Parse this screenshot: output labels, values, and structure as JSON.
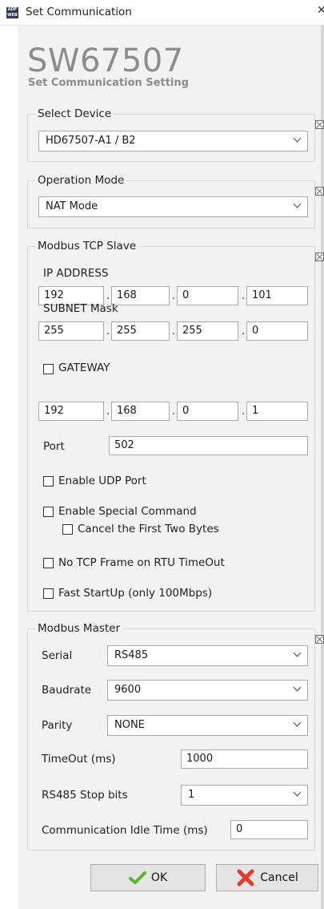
{
  "window": {
    "title": "Set Communication",
    "close_glyph": "✕"
  },
  "icons": {
    "app": "adfweb-logo-icon",
    "close": "close-icon",
    "fold": "collapse-icon",
    "chevron": "chevron-down-icon",
    "ok": "checkmark-icon",
    "cancel": "cross-icon"
  },
  "colors": {
    "ok_check": "#5cb531",
    "cancel_x": "#e23b2b"
  },
  "header": {
    "brand": "SW67507",
    "subtitle": "Set Communication Setting"
  },
  "select_device": {
    "legend": "Select Device",
    "value": "HD67507-A1 / B2"
  },
  "operation_mode": {
    "legend": "Operation Mode",
    "value": "NAT Mode"
  },
  "tcp_slave": {
    "legend": "Modbus TCP Slave",
    "ip": {
      "label": "IP ADDRESS",
      "octets": [
        "192",
        "168",
        "0",
        "101"
      ]
    },
    "subnet": {
      "label": "SUBNET Mask",
      "octets": [
        "255",
        "255",
        "255",
        "0"
      ]
    },
    "gateway": {
      "label": "GATEWAY",
      "checked": false,
      "octets": [
        "192",
        "168",
        "0",
        "1"
      ]
    },
    "port": {
      "label": "Port",
      "value": "502"
    },
    "enable_udp": {
      "label": "Enable UDP Port",
      "checked": false
    },
    "special_command": {
      "label": "Enable Special Command",
      "checked": false
    },
    "cancel_first_two": {
      "label": "Cancel the First Two Bytes",
      "checked": false
    },
    "no_tcp_frame": {
      "label": "No TCP Frame on RTU TimeOut",
      "checked": false
    },
    "fast_startup": {
      "label": "Fast StartUp (only 100Mbps)",
      "checked": false
    }
  },
  "master": {
    "legend": "Modbus Master",
    "serial": {
      "label": "Serial",
      "value": "RS485"
    },
    "baudrate": {
      "label": "Baudrate",
      "value": "9600"
    },
    "parity": {
      "label": "Parity",
      "value": "NONE"
    },
    "timeout": {
      "label": "TimeOut (ms)",
      "value": "1000"
    },
    "stop_bits": {
      "label": "RS485 Stop bits",
      "value": "1"
    },
    "idle_time": {
      "label": "Communication Idle Time (ms)",
      "value": "0"
    }
  },
  "buttons": {
    "ok": "OK",
    "cancel": "Cancel"
  }
}
